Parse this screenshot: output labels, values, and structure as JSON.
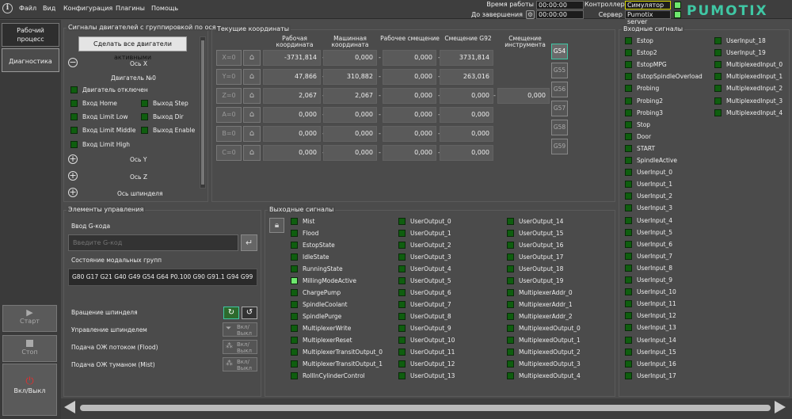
{
  "menu": {
    "file": "Файл",
    "view": "Вид",
    "config": "Конфигурация",
    "plugins": "Плагины",
    "help": "Помощь"
  },
  "status": {
    "work_time_label": "Время работы",
    "work_time": "00:00:00",
    "to_finish_label": "До завершения",
    "to_finish": "00:00:00",
    "controller_label": "Контроллер",
    "controller": "Симулятор",
    "server_label": "Сервер",
    "server": "Pumotix server"
  },
  "logo": "PUMOTIX",
  "nav": {
    "workflow": "Рабочий процесс",
    "diagnostics": "Диагностика"
  },
  "side_buttons": {
    "start": "Старт",
    "stop": "Стоп",
    "power": "Вкл/Выкл"
  },
  "motor_signals": {
    "title": "Сигналы двигателей с группировкой по осям",
    "enable_all": "Сделать все двигатели активными",
    "axis_x": "Ось X",
    "motor_no": "Двигатель №0",
    "motor_disabled": "Двигатель отключен",
    "home_in": "Вход Home",
    "step_out": "Выход Step",
    "limit_low": "Вход Limit Low",
    "dir_out": "Выход Dir",
    "limit_middle": "Вход Limit Middle",
    "enable_out": "Выход Enable",
    "limit_high": "Вход Limit High",
    "axis_y": "Ось Y",
    "axis_z": "Ось Z",
    "axis_spindle": "Ось шпинделя"
  },
  "coords": {
    "title": "Текущие координаты",
    "headers": [
      "Рабочая координата",
      "Машинная координата",
      "Рабочее смещение",
      "Смещение G92",
      "Смещение инструмента"
    ],
    "rows": [
      {
        "axis": "X=0",
        "work": "-3731,814",
        "machine": "0,000",
        "offset": "0,000",
        "g92": "3731,814",
        "tool": ""
      },
      {
        "axis": "Y=0",
        "work": "47,866",
        "machine": "310,882",
        "offset": "0,000",
        "g92": "263,016",
        "tool": ""
      },
      {
        "axis": "Z=0",
        "work": "2,067",
        "machine": "2,067",
        "offset": "0,000",
        "g92": "0,000",
        "tool": "0,000"
      },
      {
        "axis": "A=0",
        "work": "0,000",
        "machine": "0,000",
        "offset": "0,000",
        "g92": "0,000",
        "tool": ""
      },
      {
        "axis": "B=0",
        "work": "0,000",
        "machine": "0,000",
        "offset": "0,000",
        "g92": "0,000",
        "tool": ""
      },
      {
        "axis": "C=0",
        "work": "0,000",
        "machine": "0,000",
        "offset": "0,000",
        "g92": "0,000",
        "tool": ""
      }
    ],
    "g_buttons": [
      "G54",
      "G55",
      "G56",
      "G57",
      "G58",
      "G59"
    ]
  },
  "controls": {
    "title": "Элементы управления",
    "gcode_label": "Ввод G-кода",
    "gcode_placeholder": "Введите G-код",
    "modal_label": "Состояние модальных групп",
    "modal_value": "G80 G17 G21 G40 G49 G54 G64 P0.100 G90 G91.1 G94 G99",
    "spindle_rot": "Вращение шпинделя",
    "spindle_ctrl": "Управление шпинделем",
    "flood": "Подача ОЖ потоком (Flood)",
    "mist": "Подача ОЖ туманом (Mist)",
    "onoff": "Вкл/ Выкл"
  },
  "outputs": {
    "title": "Выходные сигналы",
    "col1": [
      "Mist",
      "Flood",
      "EstopState",
      "IdleState",
      "RunningState",
      "MillingModeActive",
      "ChargePump",
      "SpindleCoolant",
      "SpindlePurge",
      "MultiplexerWrite",
      "MultiplexerReset",
      "MultiplexerTransitOutput_0",
      "MultiplexerTransitOutput_1",
      "RollInCylinderControl"
    ],
    "col2": [
      "UserOutput_0",
      "UserOutput_1",
      "UserOutput_2",
      "UserOutput_3",
      "UserOutput_4",
      "UserOutput_5",
      "UserOutput_6",
      "UserOutput_7",
      "UserOutput_8",
      "UserOutput_9",
      "UserOutput_10",
      "UserOutput_11",
      "UserOutput_12",
      "UserOutput_13"
    ],
    "col3": [
      "UserOutput_14",
      "UserOutput_15",
      "UserOutput_16",
      "UserOutput_17",
      "UserOutput_18",
      "UserOutput_19",
      "MultiplexerAddr_0",
      "MultiplexerAddr_1",
      "MultiplexerAddr_2",
      "MultiplexedOutput_0",
      "MultiplexedOutput_1",
      "MultiplexedOutput_2",
      "MultiplexedOutput_3",
      "MultiplexedOutput_4"
    ]
  },
  "inputs": {
    "title": "Входные сигналы",
    "col1": [
      "Estop",
      "Estop2",
      "EstopMPG",
      "EstopSpindleOverload",
      "Probing",
      "Probing2",
      "Probing3",
      "Stop",
      "Door",
      "START",
      "SpindleActive",
      "UserInput_0",
      "UserInput_1",
      "UserInput_2",
      "UserInput_3",
      "UserInput_4",
      "UserInput_5",
      "UserInput_6",
      "UserInput_7",
      "UserInput_8",
      "UserInput_9",
      "UserInput_10",
      "UserInput_11",
      "UserInput_12",
      "UserInput_13",
      "UserInput_14",
      "UserInput_15",
      "UserInput_16",
      "UserInput_17"
    ],
    "col2": [
      "UserInput_18",
      "UserInput_19",
      "MultiplexedInput_0",
      "MultiplexedInput_1",
      "MultiplexedInput_2",
      "MultiplexedInput_3",
      "MultiplexedInput_4"
    ]
  },
  "colors": {
    "accent": "#3fc7a4",
    "indicator_off": "#0f5e0f",
    "indicator_on": "#6ee86e"
  }
}
